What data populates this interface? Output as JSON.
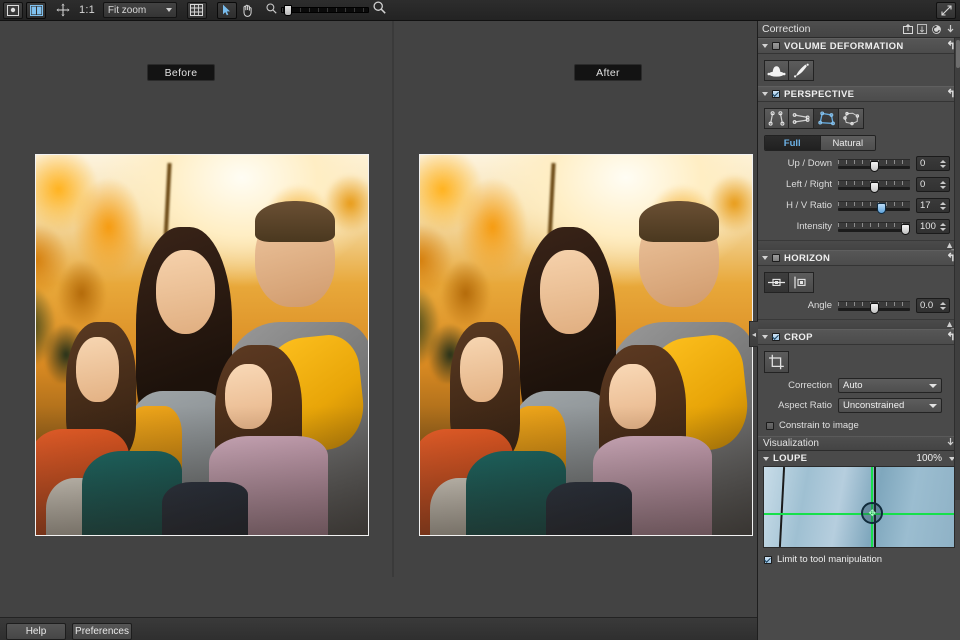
{
  "toolbar": {
    "icons": [
      "single-view-icon",
      "compare-view-icon",
      "pan-icon",
      "grid-icon",
      "pointer-icon",
      "hand-icon",
      "zoom-out-icon",
      "zoom-in-icon"
    ],
    "ratio_label": "1:1",
    "zoom_select_value": "Fit zoom",
    "maximize_icon": "maximize-icon"
  },
  "canvas": {
    "before_label": "Before",
    "after_label": "After"
  },
  "bottom": {
    "help_label": "Help",
    "preferences_label": "Preferences"
  },
  "panel": {
    "title": "Correction",
    "header_icons": [
      "export-icon",
      "import-icon",
      "reset-all-icon",
      "collapse-all-icon"
    ],
    "sections": {
      "volume_deformation": {
        "title": "VOLUME DEFORMATION",
        "checked": false,
        "expanded": true,
        "reset_icon": "reset-arrow-icon",
        "tools": [
          "volume-face-icon",
          "volume-brush-icon"
        ]
      },
      "perspective": {
        "title": "PERSPECTIVE",
        "checked": true,
        "expanded": true,
        "reset_icon": "reset-arrow-icon",
        "tools": [
          "vertical-lines-icon",
          "horizontal-lines-icon",
          "rectangle-icon",
          "eight-point-icon"
        ],
        "selected_tool_index": 2,
        "mode_options": [
          "Full",
          "Natural"
        ],
        "mode_selected": "Full",
        "sliders": [
          {
            "label": "Up / Down",
            "value": "0",
            "knob_pct": 50,
            "highlighted": false
          },
          {
            "label": "Left / Right",
            "value": "0",
            "knob_pct": 50,
            "highlighted": false
          },
          {
            "label": "H / V Ratio",
            "value": "17",
            "knob_pct": 60,
            "highlighted": true
          },
          {
            "label": "Intensity",
            "value": "100",
            "knob_pct": 100,
            "highlighted": false
          }
        ]
      },
      "horizon": {
        "title": "HORIZON",
        "checked": false,
        "expanded": true,
        "reset_icon": "reset-arrow-icon",
        "tools": [
          "horizon-horizontal-icon",
          "horizon-vertical-icon"
        ],
        "sliders": [
          {
            "label": "Angle",
            "value": "0.0",
            "knob_pct": 50,
            "highlighted": false
          }
        ]
      },
      "crop": {
        "title": "CROP",
        "checked": true,
        "expanded": true,
        "reset_icon": "reset-arrow-icon",
        "tools": [
          "crop-tool-icon"
        ],
        "correction_label": "Correction",
        "correction_value": "Auto",
        "aspect_label": "Aspect Ratio",
        "aspect_value": "Unconstrained",
        "constrain_label": "Constrain to image",
        "constrain_checked": false
      }
    },
    "visualization": {
      "title": "Visualization",
      "pin_icon": "pin-icon",
      "loupe": {
        "title": "LOUPE",
        "zoom_value": "100%",
        "cursor_icon": "move-crosshair-icon",
        "limit_label": "Limit to tool manipulation",
        "limit_checked": true
      }
    }
  },
  "colors": {
    "accent_blue": "#6db3e8",
    "panel_bg": "#4a4a4a",
    "canvas_bg": "#434343",
    "toolbar_bg": "#2d2d2d",
    "loupe_green": "#16e04a"
  }
}
